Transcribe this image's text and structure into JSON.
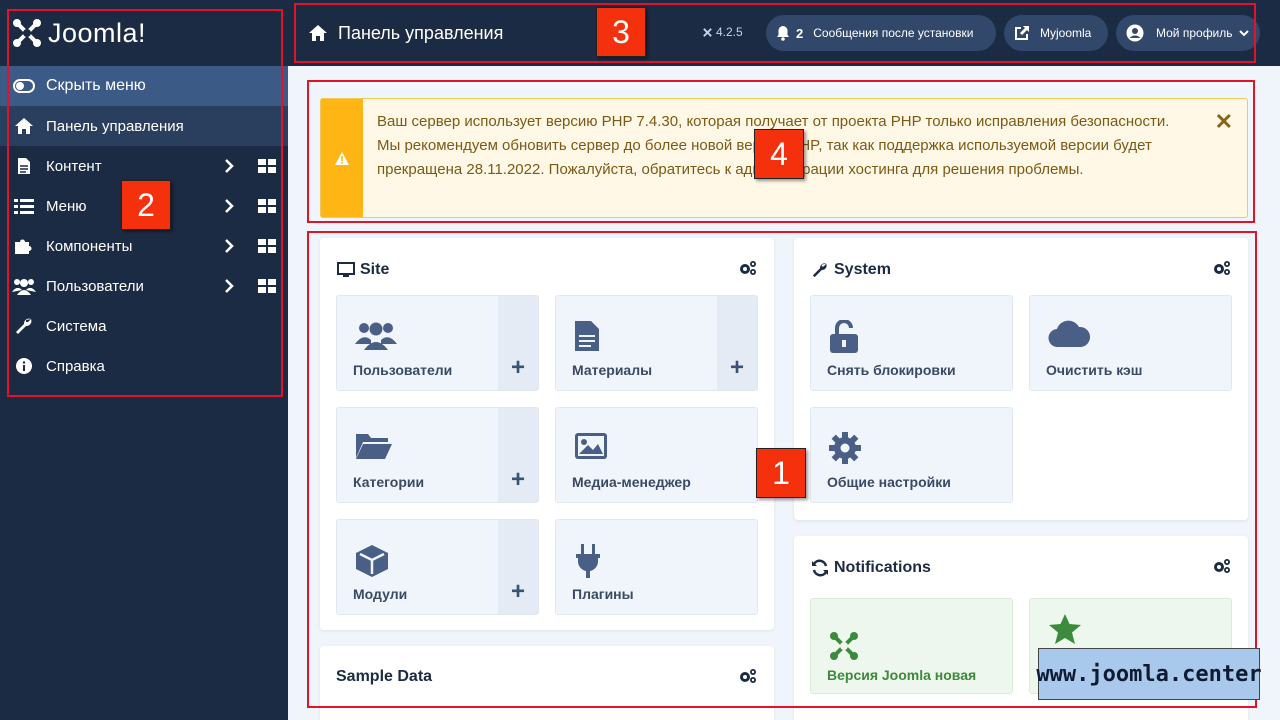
{
  "brand": {
    "logo_text": "Joomla!"
  },
  "sidebar": {
    "toggle_label": "Скрыть меню",
    "items": [
      {
        "label": "Панель управления",
        "icon": "home-icon"
      },
      {
        "label": "Контент",
        "icon": "file-icon"
      },
      {
        "label": "Меню",
        "icon": "list-icon"
      },
      {
        "label": "Компоненты",
        "icon": "puzzle-icon"
      },
      {
        "label": "Пользователи",
        "icon": "users-icon"
      },
      {
        "label": "Система",
        "icon": "wrench-icon"
      },
      {
        "label": "Справка",
        "icon": "info-icon"
      }
    ]
  },
  "header": {
    "title": "Панель управления",
    "version": "4.2.5",
    "messages_count": "2",
    "messages_label": "Сообщения после установки",
    "myjoomla_label": "Myjoomla",
    "profile_label": "Мой профиль"
  },
  "alert": {
    "text": "Ваш сервер использует версию PHP 7.4.30, которая получает от проекта PHP только исправления безопасности. Мы рекомендуем обновить сервер до более новой версии PHP, так как поддержка используемой версии будет прекращена 28.11.2022. Пожалуйста, обратитесь к администрации хостинга для решения проблемы.",
    "close_glyph": "✕"
  },
  "modules": {
    "site": {
      "title": "Site",
      "tiles": [
        {
          "label": "Пользователи",
          "icon": "users-icon",
          "add": "+"
        },
        {
          "label": "Материалы",
          "icon": "document-icon",
          "add": "+"
        },
        {
          "label": "Категории",
          "icon": "folder-icon",
          "add": "+"
        },
        {
          "label": "Медиа-менеджер",
          "icon": "image-icon"
        },
        {
          "label": "Модули",
          "icon": "cube-icon",
          "add": "+"
        },
        {
          "label": "Плагины",
          "icon": "plug-icon"
        }
      ]
    },
    "system": {
      "title": "System",
      "tiles": [
        {
          "label": "Снять блокировки",
          "icon": "unlock-icon"
        },
        {
          "label": "Очистить кэш",
          "icon": "cloud-icon"
        },
        {
          "label": "Общие настройки",
          "icon": "gear-icon"
        }
      ]
    },
    "notifications": {
      "title": "Notifications",
      "tiles": [
        {
          "label": "Версия Joomla новая",
          "icon": "joomla-icon"
        },
        {
          "label": "",
          "icon": "star-icon"
        }
      ]
    },
    "sample_data": {
      "title": "Sample Data"
    }
  },
  "annotations": [
    "1",
    "2",
    "3",
    "4"
  ],
  "watermark": "www.joomla.center",
  "colors": {
    "sidebar_bg": "#1c2b44",
    "accent": "#3b5a85",
    "warning": "#ffb514",
    "annotation": "#e1122a"
  }
}
